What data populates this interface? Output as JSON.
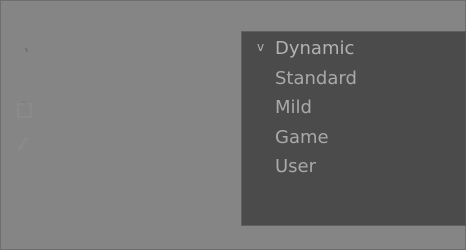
{
  "background": {
    "color": "#848484"
  },
  "dropdown": {
    "background": "#4b4b4b",
    "text_color": "#a9a9a9",
    "selected_marker": "v",
    "items": [
      {
        "label": "Dynamic",
        "selected": true
      },
      {
        "label": "Standard",
        "selected": false
      },
      {
        "label": "Mild",
        "selected": false
      },
      {
        "label": "Game",
        "selected": false
      },
      {
        "label": "User",
        "selected": false
      }
    ]
  },
  "side_icons": [
    "brush-icon",
    "document-icon",
    "pen-icon"
  ]
}
